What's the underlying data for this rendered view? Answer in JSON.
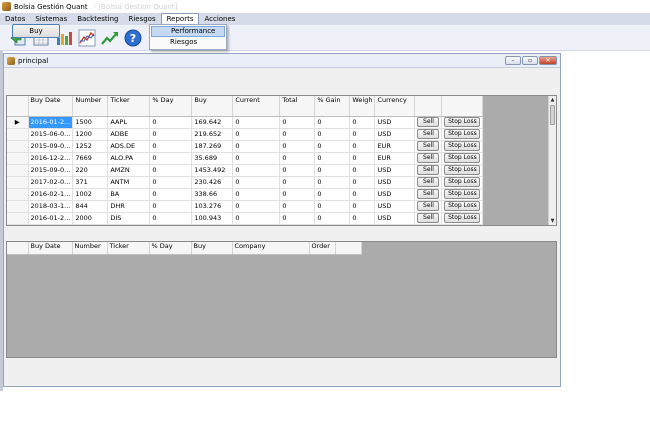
{
  "window": {
    "title": "Bolsia Gestión Quant",
    "ghost_title": "- [Bolsia Gestion Quant]"
  },
  "menu": [
    "Datos",
    "Sistemas",
    "Backtesting",
    "Riesgos",
    "Reports",
    "Acciones"
  ],
  "reports_menu": [
    "Performance",
    "Riesgos"
  ],
  "toolbar": [
    "exit-icon",
    "calendar-table-icon",
    "bar-chart-icon",
    "line-chart-icon",
    "trend-up-icon",
    "help-icon"
  ],
  "child": {
    "title": "principal",
    "buy_button": "Buy"
  },
  "grid1": {
    "columns": [
      "Buy Date",
      "Number",
      "Ticker",
      "% Day",
      "Buy",
      "Current",
      "Total",
      "% Gain",
      "Weigh",
      "Currency",
      "",
      ""
    ],
    "sell_label": "Sell",
    "stop_label": "Stop Loss",
    "rows": [
      [
        "2016-01-2...",
        "1500",
        "AAPL",
        "0",
        "169.642",
        "0",
        "0",
        "0",
        "0",
        "USD"
      ],
      [
        "2015-06-0...",
        "1200",
        "ADBE",
        "0",
        "219.652",
        "0",
        "0",
        "0",
        "0",
        "USD"
      ],
      [
        "2015-09-0...",
        "1252",
        "ADS.DE",
        "0",
        "187.269",
        "0",
        "0",
        "0",
        "0",
        "EUR"
      ],
      [
        "2016-12-2...",
        "7669",
        "ALO.PA",
        "0",
        "35.689",
        "0",
        "0",
        "0",
        "0",
        "EUR"
      ],
      [
        "2015-09-0...",
        "220",
        "AMZN",
        "0",
        "1453.492",
        "0",
        "0",
        "0",
        "0",
        "USD"
      ],
      [
        "2017-02-0...",
        "371",
        "ANTM",
        "0",
        "230.426",
        "0",
        "0",
        "0",
        "0",
        "USD"
      ],
      [
        "2016-02-1...",
        "1002",
        "BA",
        "0",
        "338.66",
        "0",
        "0",
        "0",
        "0",
        "USD"
      ],
      [
        "2018-03-1...",
        "844",
        "DHR",
        "0",
        "103.276",
        "0",
        "0",
        "0",
        "0",
        "USD"
      ],
      [
        "2016-01-2...",
        "2000",
        "DIS",
        "0",
        "100.943",
        "0",
        "0",
        "0",
        "0",
        "USD"
      ]
    ]
  },
  "grid2": {
    "columns": [
      "Buy Date",
      "Number",
      "Ticker",
      "% Day",
      "Buy",
      "Company",
      "Order",
      ""
    ]
  }
}
